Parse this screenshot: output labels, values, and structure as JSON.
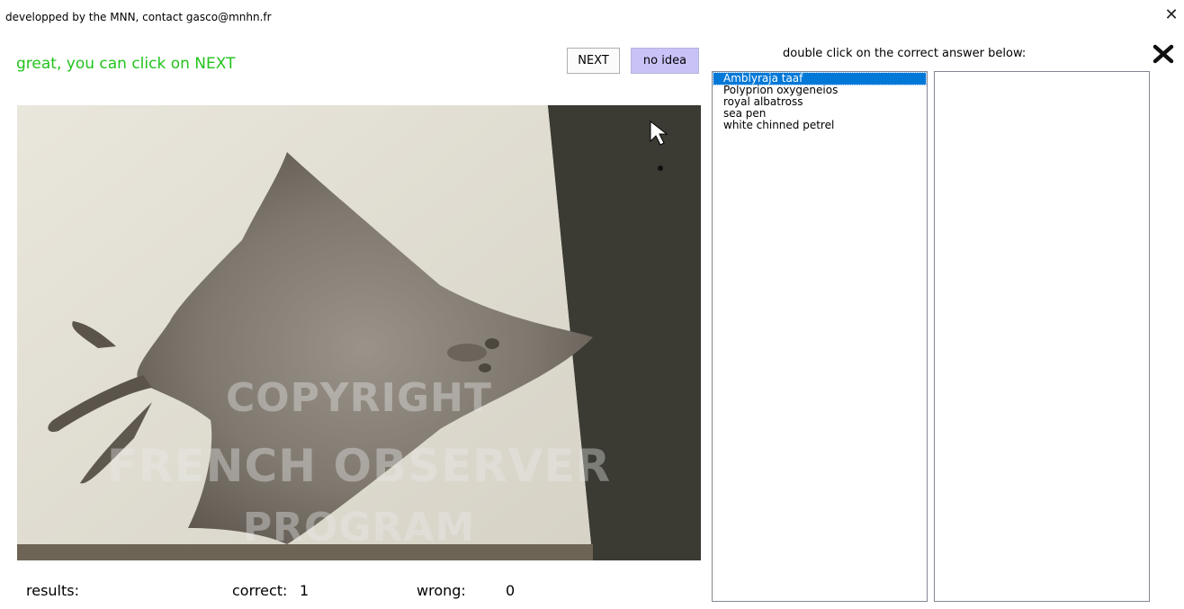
{
  "window": {
    "title": "developped by the MNN, contact gasco@mnhn.fr",
    "close_icon": "close-icon"
  },
  "status": {
    "message": "great, you can click on NEXT",
    "color": "#22c31c"
  },
  "toolbar": {
    "next_label": "NEXT",
    "no_idea_label": "no idea",
    "no_idea_color": "#c9c2f7"
  },
  "photo": {
    "watermark_lines": [
      "COPYRIGHT",
      "FRENCH OBSERVER",
      "PROGRAM"
    ]
  },
  "answers": {
    "instruction": "double click on the correct answer below:",
    "clear_icon": "x-mark-icon",
    "items": [
      {
        "label": "Amblyraja taaf",
        "selected": true
      },
      {
        "label": "Polyprion oxygeneios",
        "selected": false
      },
      {
        "label": "royal albatross",
        "selected": false
      },
      {
        "label": "sea pen",
        "selected": false
      },
      {
        "label": "white chinned petrel",
        "selected": false
      }
    ],
    "selection_color": "#0078d7"
  },
  "results": {
    "label": "results:",
    "correct_label": "correct:",
    "correct_value": "1",
    "wrong_label": "wrong:",
    "wrong_value": "0"
  }
}
